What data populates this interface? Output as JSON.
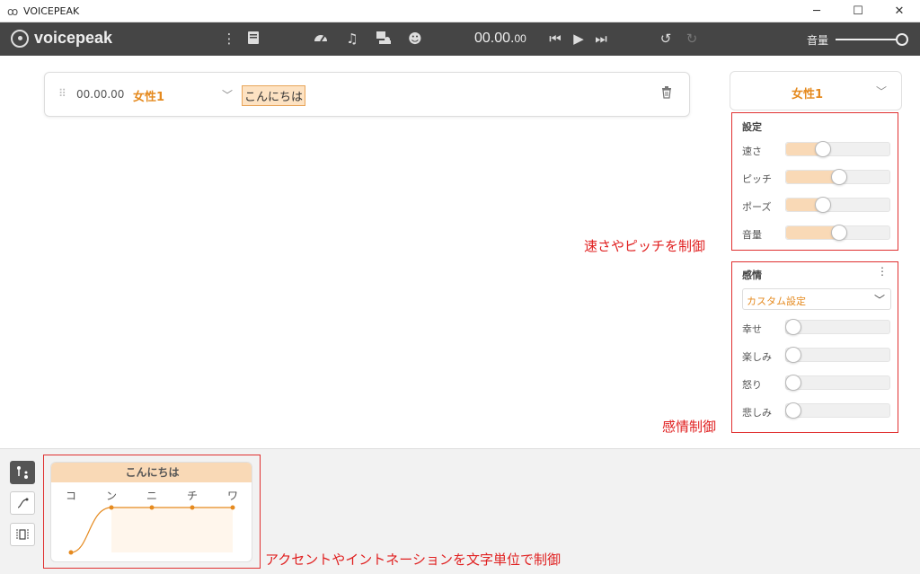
{
  "window": {
    "title": "VOICEPEAK",
    "minimize": "─",
    "maximize": "☐",
    "close": "✕"
  },
  "toolbar": {
    "logo_text": "voicepeak",
    "time_main": "00.00.",
    "time_ms": "00",
    "volume_label": "音量",
    "volume_level": 1.0,
    "icons": [
      "more-icon",
      "book-icon",
      "speed-icon",
      "music-icon",
      "character-icon",
      "emotion-icon",
      "skip-start-icon",
      "play-icon",
      "skip-end-icon",
      "undo-icon",
      "redo-icon"
    ]
  },
  "line": {
    "time": "00.00.00",
    "voice": "女性1",
    "text": "こんにちは"
  },
  "voice_panel": {
    "selected": "女性1"
  },
  "settings": {
    "title": "設定",
    "sliders": [
      {
        "label": "速さ",
        "value": 0.35
      },
      {
        "label": "ピッチ",
        "value": 0.5
      },
      {
        "label": "ポーズ",
        "value": 0.35
      },
      {
        "label": "音量",
        "value": 0.5
      }
    ]
  },
  "emotion": {
    "title": "感情",
    "preset": "カスタム設定",
    "sliders": [
      {
        "label": "幸せ",
        "value": 0
      },
      {
        "label": "楽しみ",
        "value": 0
      },
      {
        "label": "怒り",
        "value": 0
      },
      {
        "label": "悲しみ",
        "value": 0
      }
    ]
  },
  "accent": {
    "word": "こんにちは",
    "morae": [
      "コ",
      "ン",
      "ニ",
      "チ",
      "ワ"
    ],
    "pitch": [
      0,
      1,
      1,
      1,
      1
    ]
  },
  "annotations": {
    "settings": "速さやピッチを制御",
    "emotion": "感情制御",
    "accent": "アクセントやイントネーションを文字単位で制御"
  },
  "colors": {
    "accent": "#e58a1f",
    "fill": "#f9d9b6",
    "toolbar": "#454545",
    "annotation": "#e02020"
  }
}
